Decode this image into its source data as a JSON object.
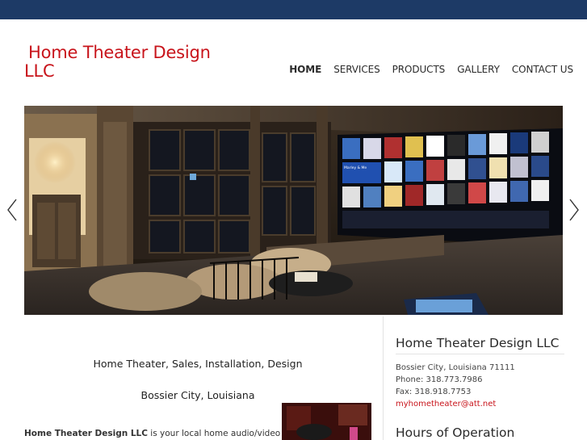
{
  "header": {
    "logo_line1": "Home Theater Design",
    "logo_line2": "LLC"
  },
  "nav": {
    "items": [
      "HOME",
      "SERVICES",
      "PRODUCTS",
      "GALLERY",
      "CONTACT US"
    ],
    "active": "HOME"
  },
  "slider": {
    "prev_icon": "chevron-left-icon",
    "next_icon": "chevron-right-icon",
    "screen_text_1": "Marley & Me",
    "screen_text_2": "A newlywed couple's troublemaking yellow Labrador becomes an inseparable member of their family."
  },
  "main": {
    "headline1": "Home Theater, Sales, Installation, Design",
    "headline2": "Bossier City, Louisiana",
    "intro_bold": "Home Theater Design LLC",
    "intro_rest": " is your local home audio/video"
  },
  "sidebar": {
    "title": "Home Theater Design LLC",
    "address": "Bossier City, Louisiana 71111",
    "phone": "Phone: 318.773.7986",
    "fax": "Fax: 318.918.7753",
    "email": "myhometheater@att.net",
    "hours_title": "Hours of Operation"
  },
  "colors": {
    "topbar": "#1d3a66",
    "brand_red": "#c8141b"
  }
}
